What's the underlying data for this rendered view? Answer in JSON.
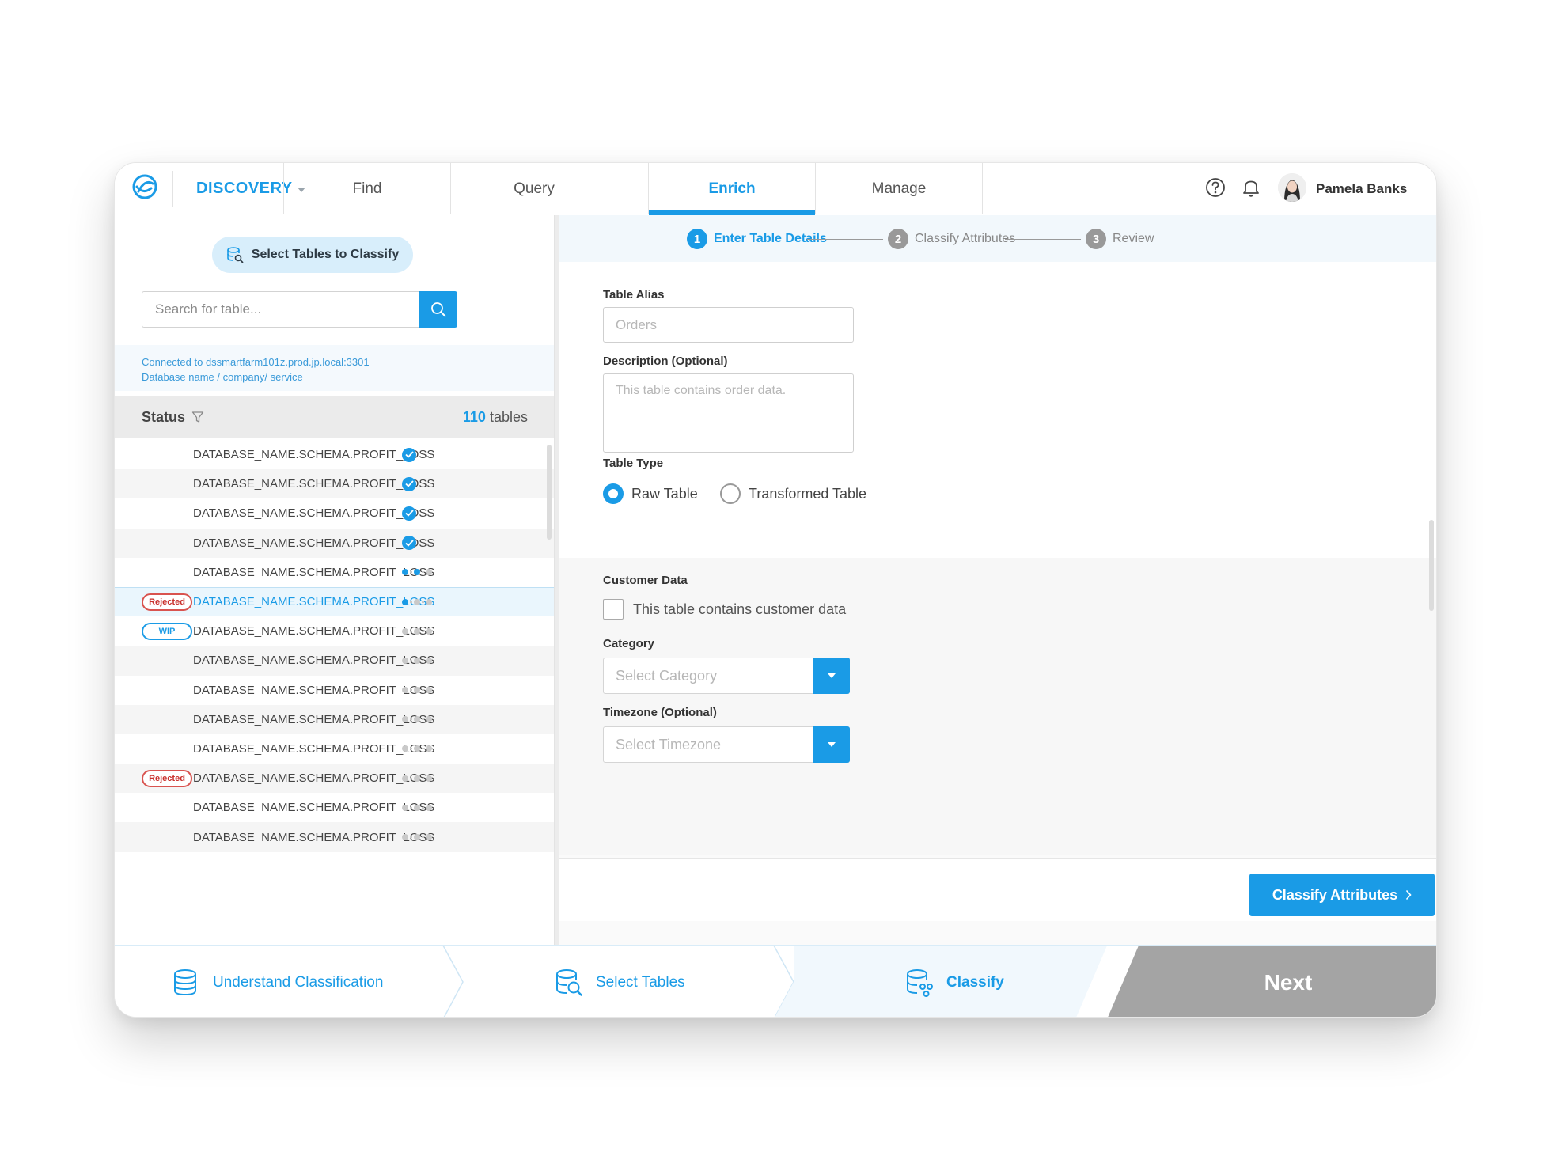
{
  "nav": {
    "brand": "DISCOVERY",
    "tabs": [
      "Find",
      "Query",
      "Enrich",
      "Manage"
    ],
    "active_tab": "Enrich",
    "user_name": "Pamela Banks"
  },
  "left": {
    "select_button": "Select Tables to Classify",
    "search_placeholder": "Search for table...",
    "connection_line1": "Connected to dssmartfarm101z.prod.jp.local:3301",
    "connection_line2": "Database name / company/ service",
    "status_label": "Status",
    "count_num": "110",
    "count_suffix": " tables",
    "rows": [
      {
        "name": "DATABASE_NAME.SCHEMA.PROFIT_LOSS",
        "badge": "",
        "status": "done"
      },
      {
        "name": "DATABASE_NAME.SCHEMA.PROFIT_LOSS",
        "badge": "",
        "status": "done"
      },
      {
        "name": "DATABASE_NAME.SCHEMA.PROFIT_LOSS",
        "badge": "",
        "status": "done"
      },
      {
        "name": "DATABASE_NAME.SCHEMA.PROFIT_LOSS",
        "badge": "",
        "status": "done"
      },
      {
        "name": "DATABASE_NAME.SCHEMA.PROFIT_LOSS",
        "badge": "",
        "status": "progress-2"
      },
      {
        "name": "DATABASE_NAME.SCHEMA.PROFIT_LOSS",
        "badge": "Rejected",
        "status": "progress-1"
      },
      {
        "name": "DATABASE_NAME.SCHEMA.PROFIT_LOSS",
        "badge": "WIP",
        "status": "progress-0"
      },
      {
        "name": "DATABASE_NAME.SCHEMA.PROFIT_LOSS",
        "badge": "",
        "status": "progress-0"
      },
      {
        "name": "DATABASE_NAME.SCHEMA.PROFIT_LOSS",
        "badge": "",
        "status": "progress-0"
      },
      {
        "name": "DATABASE_NAME.SCHEMA.PROFIT_LOSS",
        "badge": "",
        "status": "progress-0"
      },
      {
        "name": "DATABASE_NAME.SCHEMA.PROFIT_LOSS",
        "badge": "",
        "status": "progress-0"
      },
      {
        "name": "DATABASE_NAME.SCHEMA.PROFIT_LOSS",
        "badge": "Rejected",
        "status": "progress-0"
      },
      {
        "name": "DATABASE_NAME.SCHEMA.PROFIT_LOSS",
        "badge": "",
        "status": "progress-0"
      },
      {
        "name": "DATABASE_NAME.SCHEMA.PROFIT_LOSS",
        "badge": "",
        "status": "progress-0"
      }
    ],
    "selected_row": 5
  },
  "stepper": {
    "steps": [
      {
        "num": "1",
        "label": "Enter Table Details"
      },
      {
        "num": "2",
        "label": "Classify Attributes"
      },
      {
        "num": "3",
        "label": "Review"
      }
    ],
    "active_step": 1
  },
  "form": {
    "alias_label": "Table Alias",
    "alias_placeholder": "Orders",
    "description_label": "Description (Optional)",
    "description_placeholder": "This table contains order data.",
    "type_label": "Table Type",
    "type_options": [
      "Raw Table",
      "Transformed Table"
    ],
    "type_selected": "Raw Table",
    "customer_label": "Customer Data",
    "customer_checkbox": "This table contains customer data",
    "customer_checked": false,
    "category_label": "Category",
    "category_placeholder": "Select Category",
    "timezone_label": "Timezone (Optional)",
    "timezone_placeholder": "Select Timezone",
    "submit": "Classify Attributes"
  },
  "wizard": {
    "steps": [
      "Understand Classification",
      "Select Tables",
      "Classify"
    ],
    "current": "Classify",
    "next": "Next"
  },
  "colors": {
    "accent": "#1a9be6",
    "rejected": "#d9534f",
    "next_bg": "#a4a4a4"
  }
}
